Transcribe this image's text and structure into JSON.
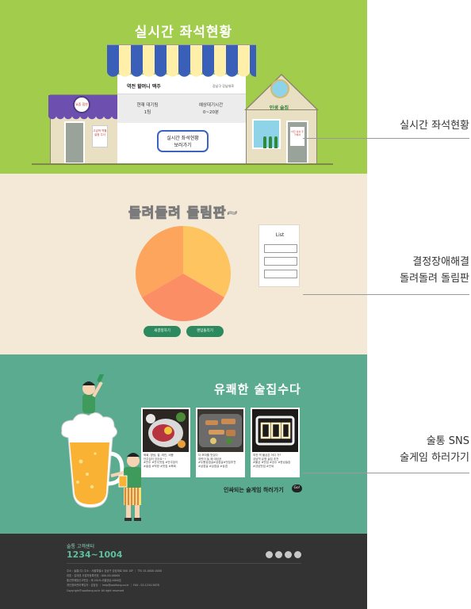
{
  "section_seats": {
    "title": "실시간 좌석현황",
    "left_shop": {
      "sign": "요즘 힙한",
      "note": "고급적 역할 설정 주사"
    },
    "center_shop": {
      "name": "역전 할머니 맥주",
      "location": "강남구 강남대로",
      "wait_label": "현재 대기팀",
      "wait_value": "1팀",
      "time_label": "예상대기시간",
      "time_value": "0~20분",
      "button_line1": "실시간 좌석현황",
      "button_line2": "보러가기"
    },
    "right_shop": {
      "sign": "인생 술집",
      "note": "이전 상상 추가해서"
    }
  },
  "section_roulette": {
    "title": "돌려돌려 돌림판~",
    "list_title": "List",
    "list_fields": [
      "",
      "",
      ""
    ],
    "buttons": [
      "새결정하기",
      "랜덤돌리기"
    ],
    "colors": {
      "slice1": "#fdc45f",
      "slice2": "#fb8e64",
      "slice3": "#fda55c"
    }
  },
  "section_sns": {
    "title": "유쾌한 술집수다",
    "cards": [
      {
        "image": "raw-beef-photo",
        "text": [
          "육회, 양념, 잘, 와인, 비용",
          "안주집이 있어요~!",
          "#안주 #안주맛집 #안주집이",
          "#술집 #먹방 #맛집 #육회"
        ]
      },
      {
        "image": "grilled-meat-photo",
        "text": [
          "더 보여줄 맛있다",
          "여럿이 놀 때 대성공",
          "#두툼삼겹살#삼겹살#맛집추천",
          "#삼겹살 #삼겹살 #삼겹"
        ]
      },
      {
        "image": "neon-sign-photo",
        "text": [
          "여전 역 불금은 어디 가?",
          "강남역 유명 술집 추천",
          "#불금 #맛집 #강주 #한남술집",
          "#강남맛집 #인싸"
        ]
      }
    ],
    "cta": "인싸되는 술게임 하러가기",
    "cta_badge": "Go!"
  },
  "footer": {
    "cs_label": "술통 고객센터",
    "phone": "1234~1004",
    "info": [
      "주소 : 술통(주) 주소 : 서울특별시 강남구 강남대로 000 10F ｜ TEL 01-0000-0000",
      "대표 : 김대표 사업자등록번호 : 000-00-00000",
      "통신판매업신고번호 : 제 2019-서울강남-0000호",
      "개인정보관리책임자 : 김담당 ｜ help@sooltong.co.kr ｜ FAX : 02-1234-5678"
    ],
    "copyright": "Copyright©sooltong.co.kr All right reserved"
  },
  "annotations": {
    "seats": "실시간 좌석현황",
    "roulette": [
      "결정장애해결",
      "돌려돌려 돌림판"
    ],
    "sns": [
      "술통 SNS",
      "술게임 하러가기"
    ]
  }
}
